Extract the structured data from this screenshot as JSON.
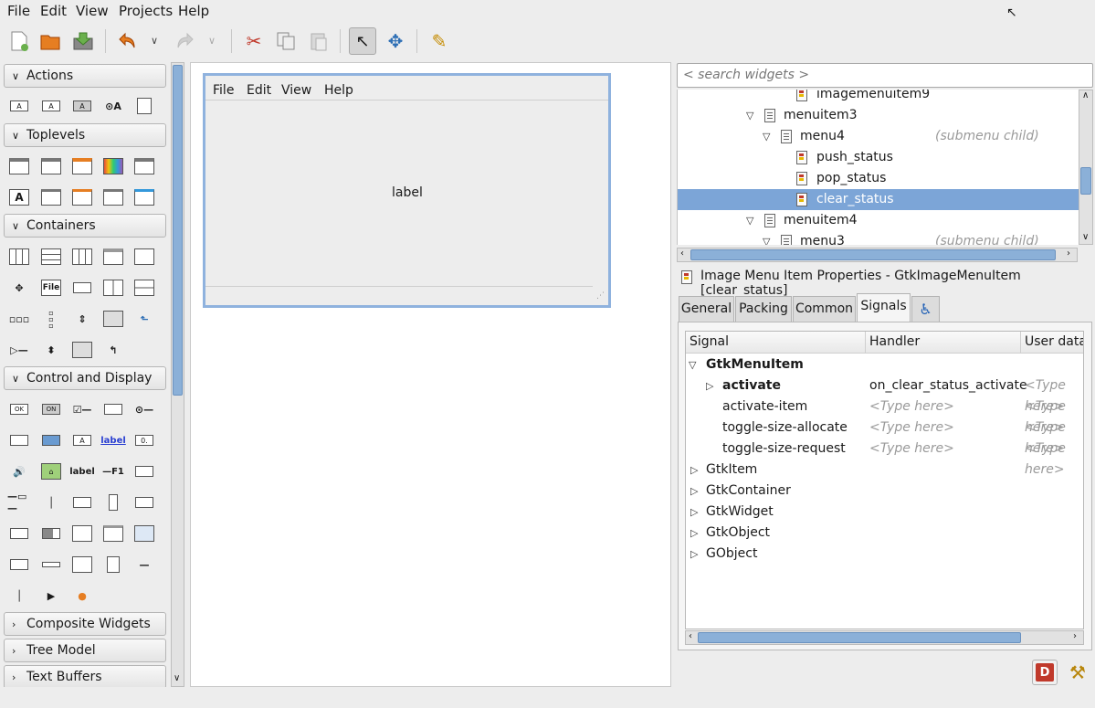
{
  "menubar": [
    "File",
    "Edit",
    "View",
    "Projects",
    "Help"
  ],
  "palette": {
    "groups": {
      "actions": "Actions",
      "toplevels": "Toplevels",
      "containers": "Containers",
      "control": "Control and Display",
      "composite": "Composite Widgets",
      "treemodel": "Tree Model",
      "textbuffers": "Text Buffers"
    },
    "icon_text": {
      "file": "File",
      "ok": "OK",
      "on": "ON",
      "label": "label",
      "label_plain": "label",
      "f1": "—F1",
      "zero": "0."
    }
  },
  "design": {
    "menus": [
      "File",
      "Edit",
      "View",
      "Help"
    ],
    "label": "label"
  },
  "search": {
    "placeholder": "< search widgets >"
  },
  "tree": {
    "rows": [
      {
        "name": "imagemenuitem9",
        "hint": ""
      },
      {
        "name": "menuitem3",
        "hint": ""
      },
      {
        "name": "menu4",
        "hint": "(submenu child)"
      },
      {
        "name": "push_status",
        "hint": ""
      },
      {
        "name": "pop_status",
        "hint": ""
      },
      {
        "name": "clear_status",
        "hint": ""
      },
      {
        "name": "menuitem4",
        "hint": ""
      },
      {
        "name": "menu3",
        "hint": "(submenu child)"
      }
    ]
  },
  "properties": {
    "title": "Image Menu Item Properties - GtkImageMenuItem [clear_status]",
    "tabs": [
      "General",
      "Packing",
      "Common",
      "Signals"
    ],
    "columns": [
      "Signal",
      "Handler",
      "User data"
    ],
    "signals": [
      {
        "name": "GtkMenuItem",
        "handler": "",
        "userdata": ""
      },
      {
        "name": "activate",
        "handler": "on_clear_status_activate",
        "userdata": "<Type here>"
      },
      {
        "name": "activate-item",
        "handler": "<Type here>",
        "userdata": "<Type here>"
      },
      {
        "name": "toggle-size-allocate",
        "handler": "<Type here>",
        "userdata": "<Type here>"
      },
      {
        "name": "toggle-size-request",
        "handler": "<Type here>",
        "userdata": "<Type here>"
      },
      {
        "name": "GtkItem",
        "handler": "",
        "userdata": ""
      },
      {
        "name": "GtkContainer",
        "handler": "",
        "userdata": ""
      },
      {
        "name": "GtkWidget",
        "handler": "",
        "userdata": ""
      },
      {
        "name": "GtkObject",
        "handler": "",
        "userdata": ""
      },
      {
        "name": "GObject",
        "handler": "",
        "userdata": ""
      }
    ]
  },
  "colors": {
    "selection": "#7ca5d7",
    "accent": "#8fb2de"
  }
}
